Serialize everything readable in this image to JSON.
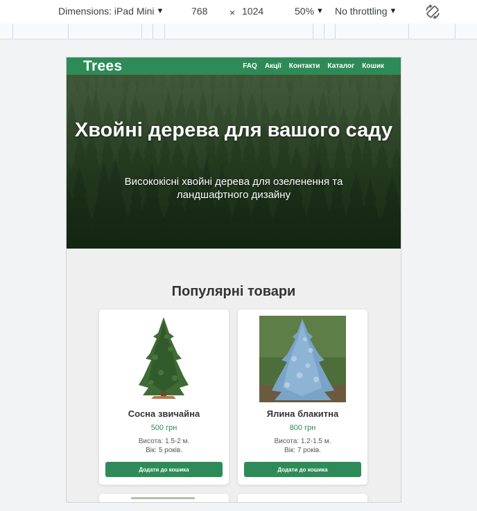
{
  "devtools": {
    "dimensions_label": "Dimensions: iPad Mini",
    "width": "768",
    "times_sign": "×",
    "height": "1024",
    "zoom": "50%",
    "throttling": "No throttling"
  },
  "site": {
    "logo": "Trees",
    "nav": [
      "FAQ",
      "Акції",
      "Контакти",
      "Каталог",
      "Кошик"
    ],
    "hero_title": "Хвойні дерева для вашого саду",
    "hero_subtitle": "Висококісні хвойні дерева для озеленення та ландшафтного дизайну",
    "popular_title": "Популярні товари",
    "products": [
      {
        "name": "Сосна звичайна",
        "price": "500 грн",
        "height": "Висота: 1.5-2 м.",
        "age": "Вік: 5 років.",
        "button": "Додати до кошика",
        "image_icon": "green-pine-tree"
      },
      {
        "name": "Ялина блакитна",
        "price": "800 грн",
        "height": "Висота: 1.2-1.5 м.",
        "age": "Вік: 7 років.",
        "button": "Додати до кошика",
        "image_icon": "blue-spruce-tree"
      }
    ]
  },
  "colors": {
    "brand_green": "#2e8b57",
    "page_bg": "#efefef"
  }
}
